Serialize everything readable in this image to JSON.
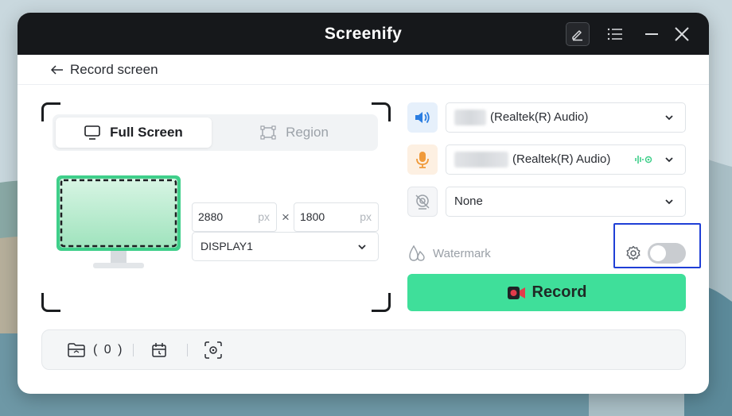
{
  "app": {
    "title": "Screenify"
  },
  "titlebar": {
    "icons": [
      "edit-icon",
      "menu-icon",
      "minimize-icon",
      "close-icon"
    ]
  },
  "subheader": {
    "back_label": "Record screen"
  },
  "capture": {
    "tabs": [
      {
        "label": "Full Screen",
        "icon": "monitor-icon",
        "selected": true
      },
      {
        "label": "Region",
        "icon": "region-icon",
        "selected": false
      }
    ],
    "width_value": "2880",
    "height_value": "1800",
    "unit": "px",
    "times_symbol": "×",
    "display_value": "DISPLAY1"
  },
  "audio": {
    "speaker_value": "(Realtek(R) Audio)",
    "mic_value": "(Realtek(R) Audio)",
    "camera_value": "None"
  },
  "watermark": {
    "label": "Watermark",
    "enabled": false
  },
  "record": {
    "label": "Record"
  },
  "bottom": {
    "recordings_count": "( 0 )"
  },
  "colors": {
    "titlebar": "#16181b",
    "accent_green": "#3fdf9a",
    "highlight_box": "#1f3fd6",
    "speaker_blue": "#2a7de1",
    "mic_orange": "#f09a3a"
  }
}
